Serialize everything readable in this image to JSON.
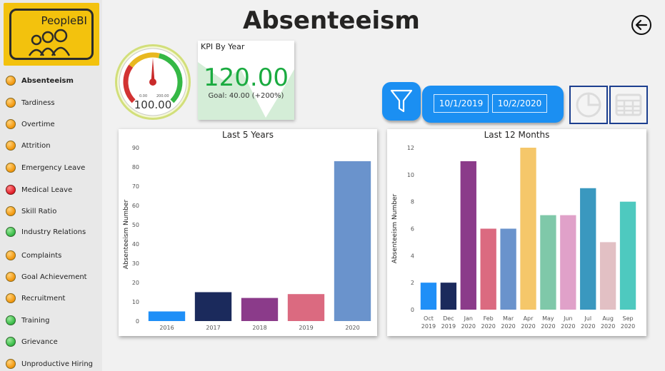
{
  "app": {
    "logo_text": "PeopleBI",
    "page_title": "Absenteeism"
  },
  "sidebar": {
    "items": [
      {
        "label": "Absenteeism",
        "status": "orange",
        "active": true
      },
      {
        "label": "Tardiness",
        "status": "orange"
      },
      {
        "label": "Overtime",
        "status": "orange"
      },
      {
        "label": "Attrition",
        "status": "orange"
      },
      {
        "label": "Emergency Leave",
        "status": "orange"
      },
      {
        "label": "Medical Leave",
        "status": "red"
      },
      {
        "label": "Skill Ratio",
        "status": "orange"
      },
      {
        "label": "Industry Relations",
        "status": "green"
      },
      {
        "label": "Complaints",
        "status": "orange"
      },
      {
        "label": "Goal Achievement",
        "status": "orange"
      },
      {
        "label": "Recruitment",
        "status": "orange"
      },
      {
        "label": "Training",
        "status": "green"
      },
      {
        "label": "Grievance",
        "status": "green"
      },
      {
        "label": "Unproductive Hiring",
        "status": "orange"
      }
    ]
  },
  "gauge": {
    "value": "100.00",
    "min_label": "0.00",
    "max_label": "200.00",
    "value_number": 100,
    "max_number": 200
  },
  "kpi": {
    "title": "KPI By Year",
    "value": "120.00",
    "goal": "Goal: 40.00 (+200%)"
  },
  "filters": {
    "date_start": "10/1/2019",
    "date_end": "10/2/2020"
  },
  "colors": {
    "accent": "#1b8ff2",
    "kpi_green": "#1aab40",
    "status_orange": "#f39a12",
    "status_red": "#e4202b",
    "status_green": "#3cbd4a"
  },
  "icons": {
    "back": "back-arrow-icon",
    "filter": "funnel-icon",
    "pie": "pie-chart-icon",
    "table": "table-icon"
  },
  "chart_data": [
    {
      "type": "bar",
      "title": "Last 5 Years",
      "xlabel": "",
      "ylabel": "Absenteeism Number",
      "categories": [
        "2016",
        "2017",
        "2018",
        "2019",
        "2020"
      ],
      "values": [
        5,
        15,
        12,
        14,
        83
      ],
      "colors": [
        "#118dff",
        "#12239e",
        "#744ec2",
        "#e66c37",
        "#6b93cc"
      ],
      "bar_colors_actual": [
        "#1f8ff7",
        "#1b2a5c",
        "#8b3b8a",
        "#db6a80",
        "#6a93cc"
      ],
      "ylim": [
        0,
        90
      ],
      "yticks": [
        0,
        10,
        20,
        30,
        40,
        50,
        60,
        70,
        80,
        90
      ],
      "grid": false
    },
    {
      "type": "bar",
      "title": "Last 12 Months",
      "xlabel": "",
      "ylabel": "Absenteeism Number",
      "categories": [
        [
          "Oct",
          "2019"
        ],
        [
          "Dec",
          "2019"
        ],
        [
          "Jan",
          "2020"
        ],
        [
          "Feb",
          "2020"
        ],
        [
          "Mar",
          "2020"
        ],
        [
          "Apr",
          "2020"
        ],
        [
          "May",
          "2020"
        ],
        [
          "Jun",
          "2020"
        ],
        [
          "Jul",
          "2020"
        ],
        [
          "Aug",
          "2020"
        ],
        [
          "Sep",
          "2020"
        ]
      ],
      "values": [
        2,
        2,
        11,
        6,
        6,
        12,
        7,
        7,
        9,
        5,
        8
      ],
      "bar_colors_actual": [
        "#1f8ff7",
        "#1b2a5c",
        "#8b3b8a",
        "#db6a80",
        "#6a93cc",
        "#f5c76a",
        "#7fc8a9",
        "#e0a1c9",
        "#3a98bf",
        "#e2c0c4",
        "#4ec9bf"
      ],
      "ylim": [
        0,
        12
      ],
      "yticks": [
        0,
        2,
        4,
        6,
        8,
        10,
        12
      ],
      "grid": false
    }
  ]
}
